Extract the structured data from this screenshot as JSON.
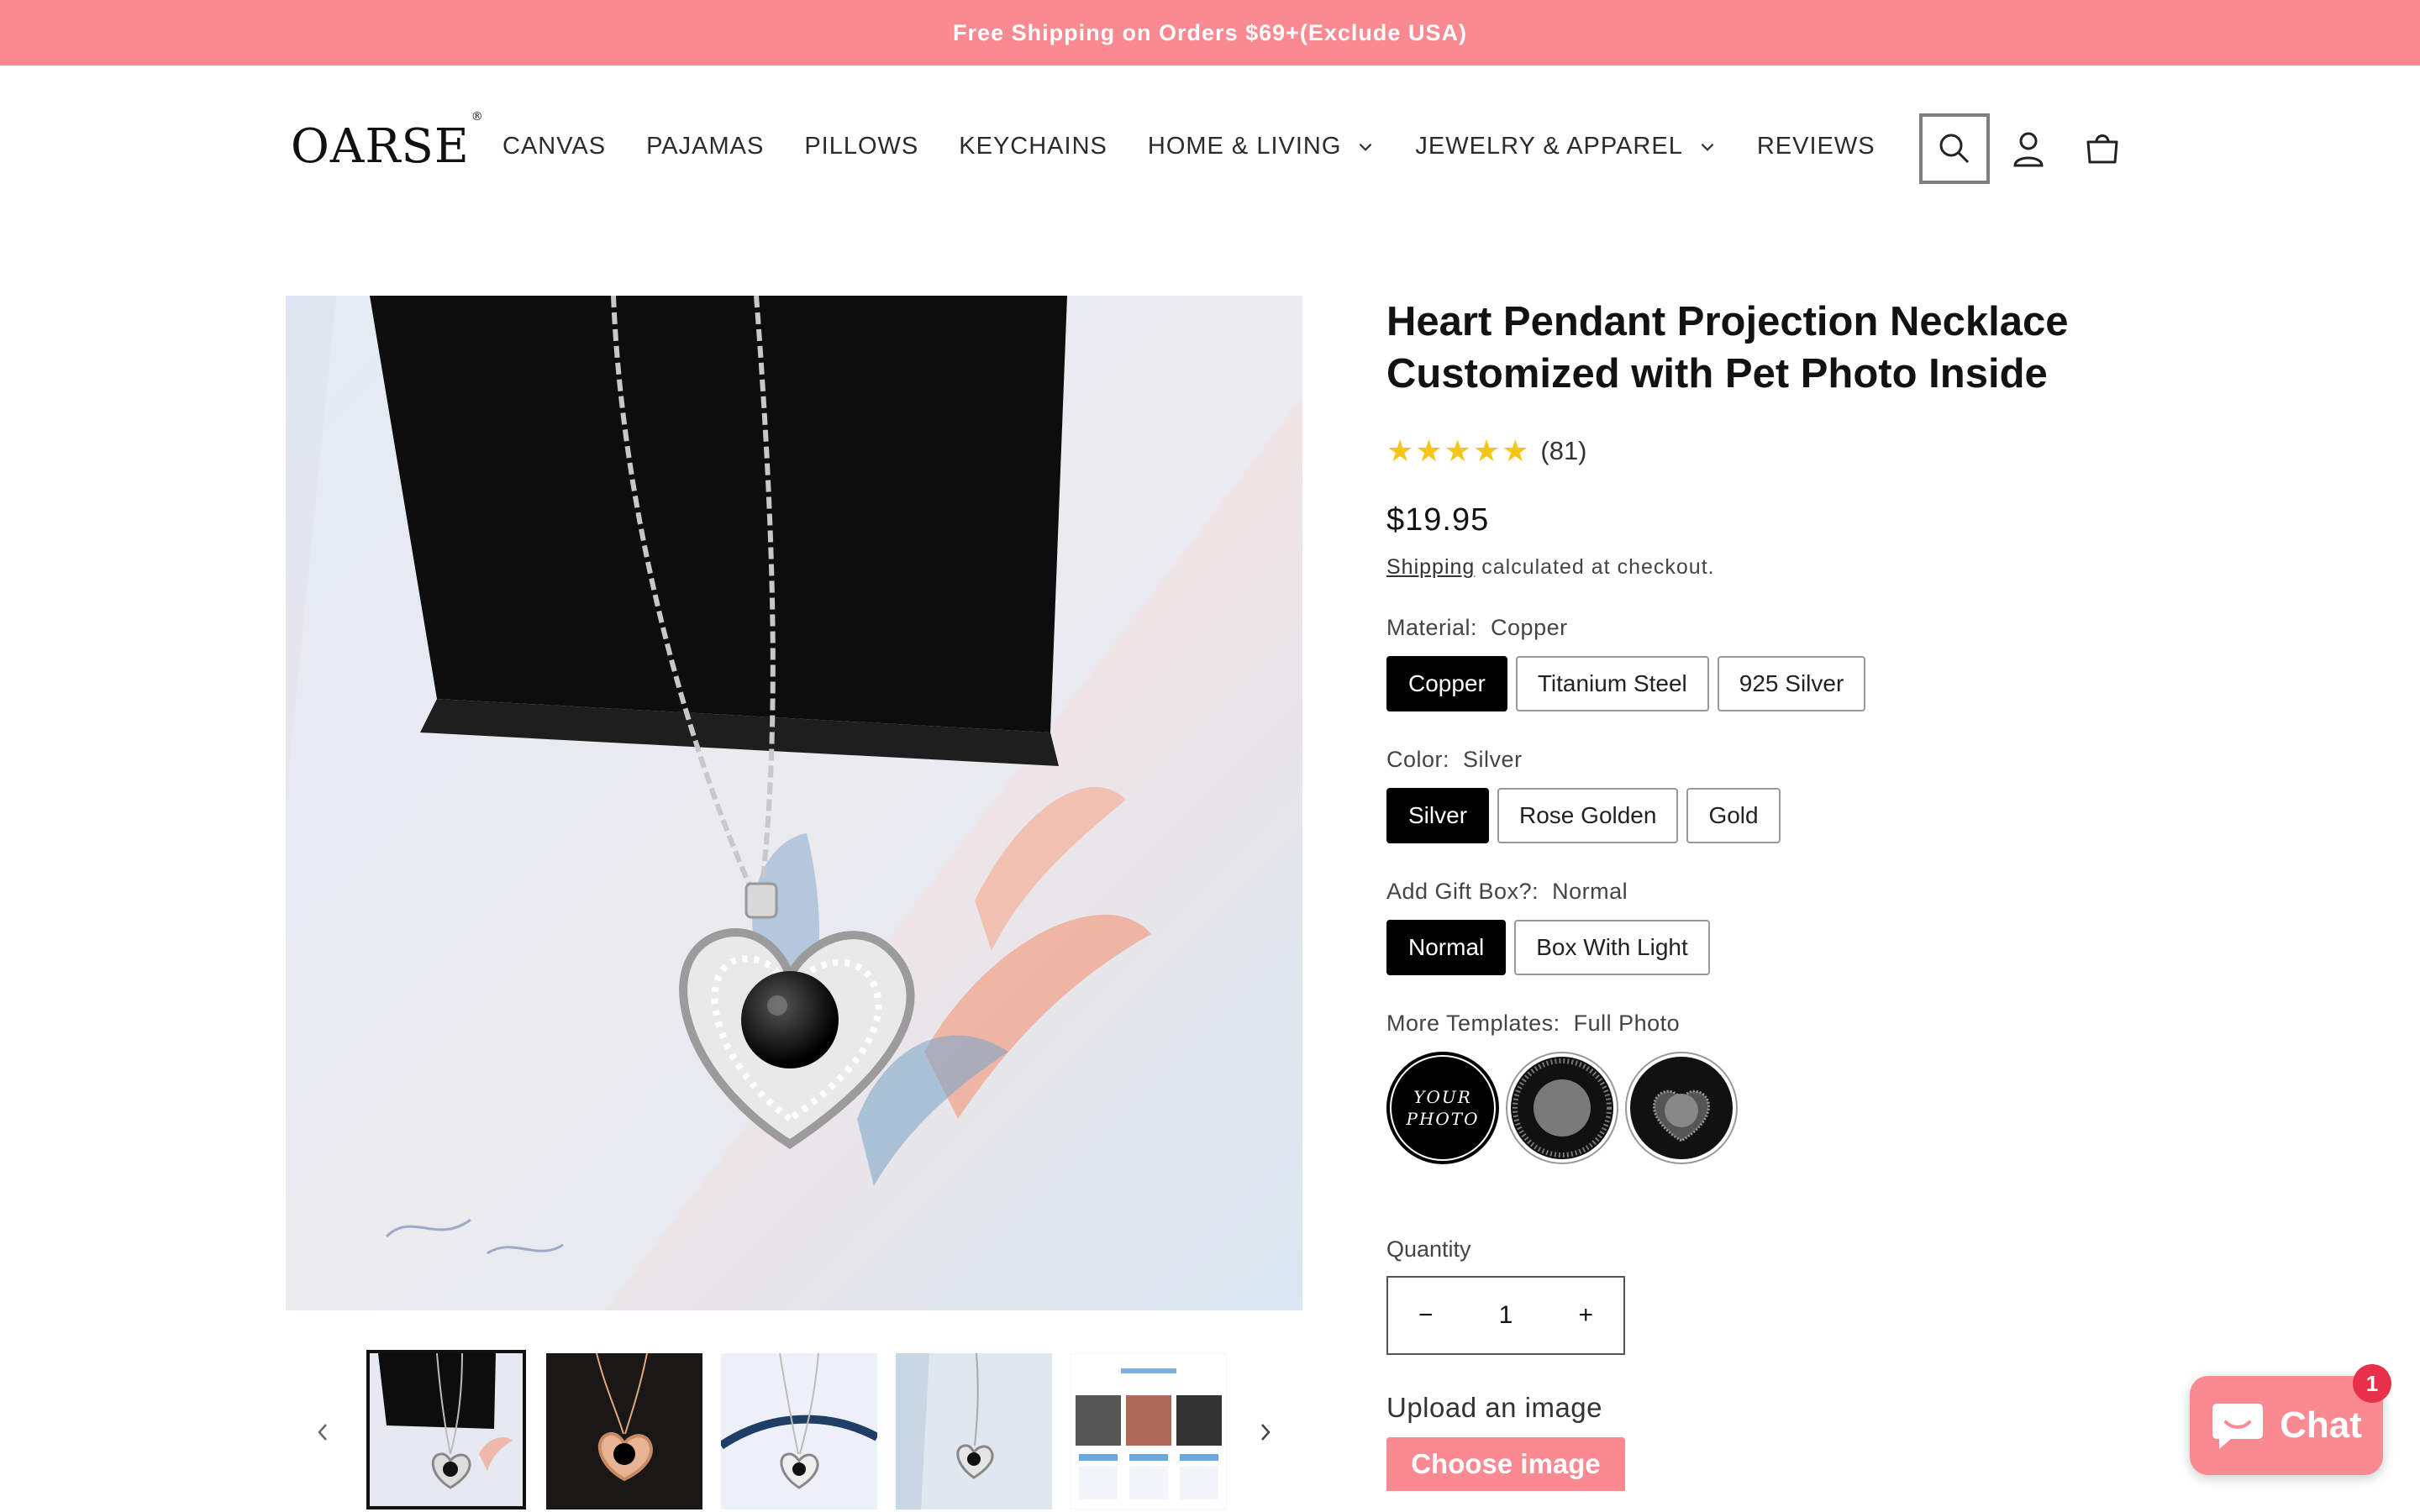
{
  "announcement": "Free Shipping on Orders $69+(Exclude USA)",
  "brand": {
    "name": "OARSE",
    "mark": "®"
  },
  "nav": [
    {
      "label": "CANVAS"
    },
    {
      "label": "PAJAMAS"
    },
    {
      "label": "PILLOWS"
    },
    {
      "label": "KEYCHAINS"
    },
    {
      "label": "HOME & LIVING"
    },
    {
      "label": "JEWELRY & APPAREL"
    },
    {
      "label": "REVIEWS"
    }
  ],
  "header_icons": [
    "search-icon",
    "account-icon",
    "cart-icon"
  ],
  "product": {
    "title": "Heart Pendant Projection Necklace Customized with Pet Photo Inside",
    "stars": "★★★★★",
    "rating_count": "(81)",
    "rating_value": 5,
    "price": "$19.95",
    "shipping_link": "Shipping",
    "shipping_text": " calculated at checkout."
  },
  "options": {
    "material": {
      "label": "Material:",
      "selected": "Copper",
      "values": [
        "Copper",
        "Titanium Steel",
        "925 Silver"
      ]
    },
    "color": {
      "label": "Color:",
      "selected": "Silver",
      "values": [
        "Silver",
        "Rose Golden",
        "Gold"
      ]
    },
    "gift_box": {
      "label": "Add Gift Box?:",
      "selected": "Normal",
      "values": [
        "Normal",
        "Box With Light"
      ]
    },
    "templates": {
      "label": "More Templates:",
      "selected": "Full Photo",
      "swatch_text": "YOUR PHOTO"
    }
  },
  "quantity": {
    "label": "Quantity",
    "value": "1",
    "minus": "−",
    "plus": "+"
  },
  "upload": {
    "label": "Upload an image",
    "button": "Choose image"
  },
  "chat": {
    "label": "Chat",
    "badge": "1"
  },
  "colors": {
    "accent": "#f98a91",
    "badge": "#e8304b",
    "star": "#f5c518"
  }
}
